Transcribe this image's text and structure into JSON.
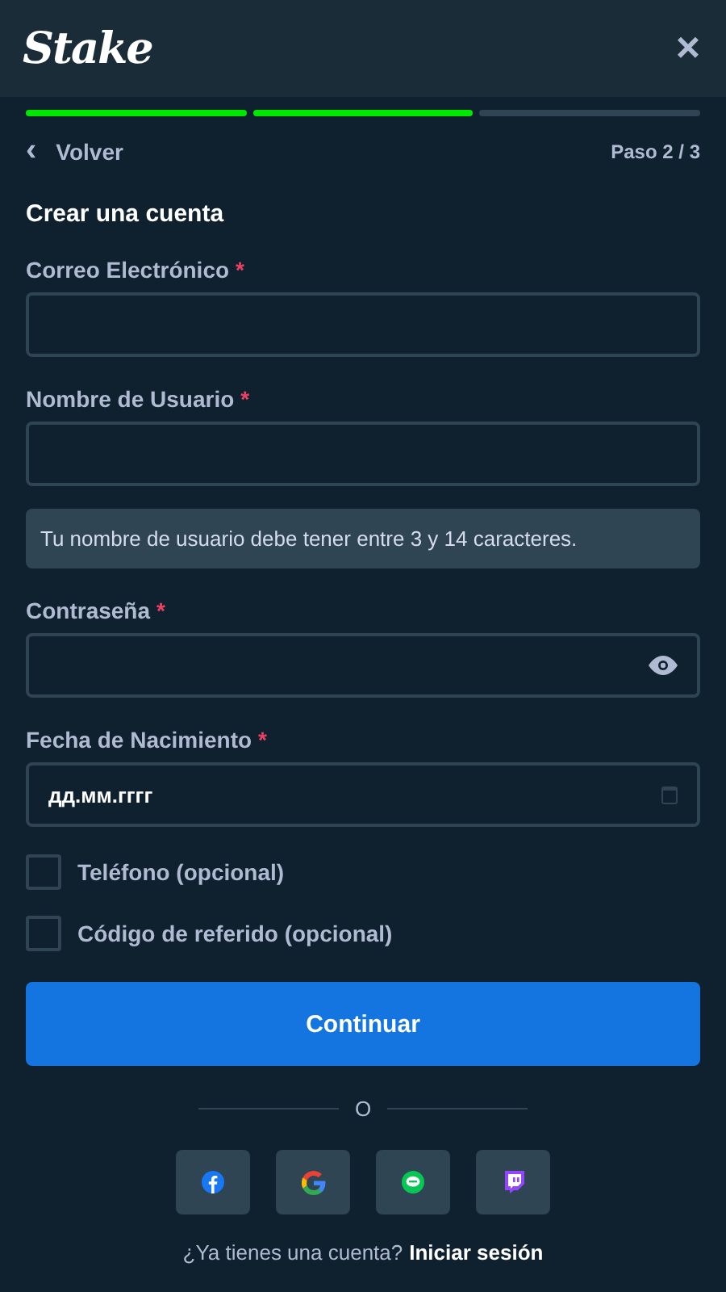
{
  "header": {
    "logo": "Stake",
    "close": "×"
  },
  "progress": [
    {
      "done": true
    },
    {
      "done": true
    },
    {
      "done": false
    }
  ],
  "back": {
    "icon": "‹",
    "label": "Volver"
  },
  "step": "Paso 2 / 3",
  "title": "Crear una cuenta",
  "required_mark": "*",
  "fields": [
    {
      "kind": "text",
      "label": "Correo Electrónico",
      "required": true
    },
    {
      "kind": "text",
      "label": "Nombre de Usuario",
      "required": true,
      "hint": "Tu nombre de usuario debe tener entre 3 y 14 caracteres."
    },
    {
      "kind": "password",
      "label": "Contraseña",
      "required": true
    },
    {
      "kind": "date",
      "label": "Fecha de Nacimiento",
      "required": true,
      "placeholder": "дд.мм.гггг"
    }
  ],
  "options": [
    {
      "label": "Teléfono (opcional)",
      "checked": false
    },
    {
      "label": "Código de referido (opcional)",
      "checked": false
    }
  ],
  "submit": "Continuar",
  "divider": "O",
  "social": [
    {
      "kind": "facebook"
    },
    {
      "kind": "google"
    },
    {
      "kind": "line"
    },
    {
      "kind": "twitch"
    }
  ],
  "footer": {
    "text": "¿Ya tienes una cuenta?",
    "link": "Iniciar sesión"
  }
}
